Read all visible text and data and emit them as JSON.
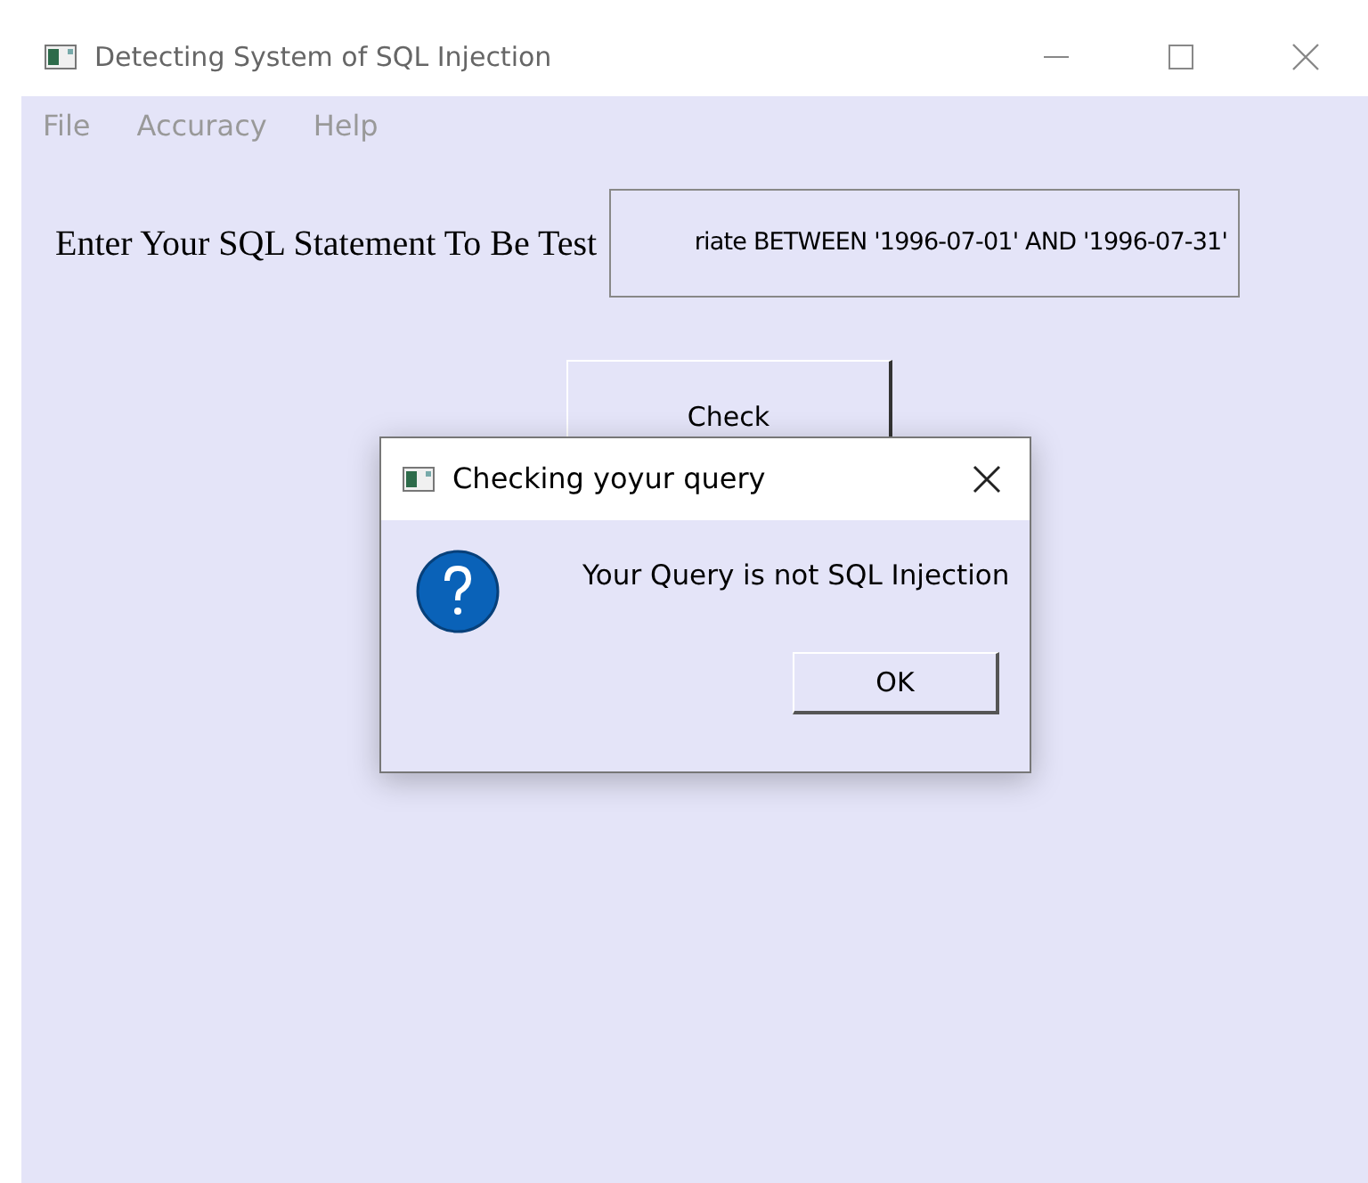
{
  "window": {
    "title": "Detecting System of SQL Injection"
  },
  "menu": [
    "File",
    "Accuracy",
    "Help"
  ],
  "prompt": "Enter Your SQL Statement To Be Test",
  "query_field": {
    "value": "riate BETWEEN '1996-07-01' AND '1996-07-31'"
  },
  "check_button": "Check",
  "dialog": {
    "title": "Checking yoyur query",
    "message": "Your Query is not SQL Injection",
    "button": "OK"
  }
}
